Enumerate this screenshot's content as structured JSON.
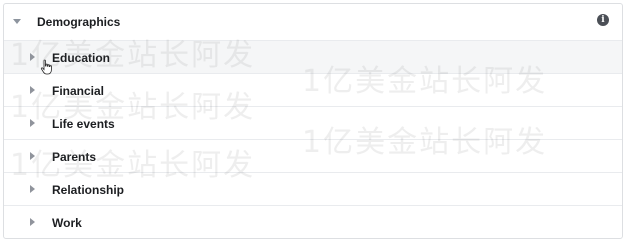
{
  "panel": {
    "title": "Demographics",
    "info_icon": "info-icon"
  },
  "rows": [
    {
      "label": "Education"
    },
    {
      "label": "Financial"
    },
    {
      "label": "Life events"
    },
    {
      "label": "Parents"
    },
    {
      "label": "Relationship"
    },
    {
      "label": "Work"
    }
  ],
  "watermark": "1亿美金站长阿发",
  "colors": {
    "border": "#dddfe2",
    "text": "#1c1e21",
    "icon": "#4b4f56",
    "chevron": "#90949c"
  }
}
